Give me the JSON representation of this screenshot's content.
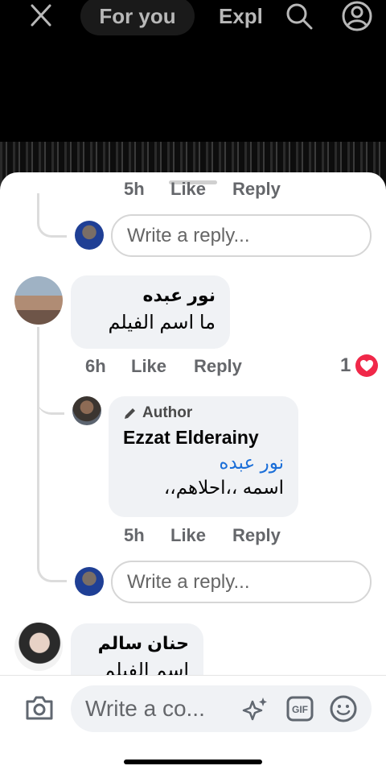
{
  "top_nav": {
    "tab_for_you": "For you",
    "tab_explore": "Expl"
  },
  "comments": {
    "prev_reply_meta": {
      "time": "5h",
      "like": "Like",
      "reply": "Reply"
    },
    "reply_placeholder_1": "Write a reply...",
    "comment_1": {
      "author": "نور عبده",
      "text": "ما اسم الفيلم",
      "time": "6h",
      "like": "Like",
      "reply": "Reply",
      "reaction_count": "1"
    },
    "author_reply": {
      "badge": "Author",
      "author": "Ezzat Elderainy",
      "mention": "نور عبده",
      "text": "اسمه ،،احلاهم،،",
      "time": "5h",
      "like": "Like",
      "reply": "Reply"
    },
    "reply_placeholder_2": "Write a reply...",
    "comment_2": {
      "author": "حنان سالم",
      "text": "اسم الفيلم"
    }
  },
  "composer": {
    "placeholder": "Write a co..."
  },
  "colors": {
    "mention": "#1a6ed8",
    "meta_gray": "#65676b",
    "bubble_bg": "#f0f2f5",
    "heart": "#f02849"
  },
  "icons": [
    "close-icon",
    "search-icon",
    "profile-icon",
    "heart-reaction-icon",
    "pencil-icon",
    "camera-icon",
    "sparkle-sticker-icon",
    "gif-icon",
    "emoji-icon"
  ]
}
